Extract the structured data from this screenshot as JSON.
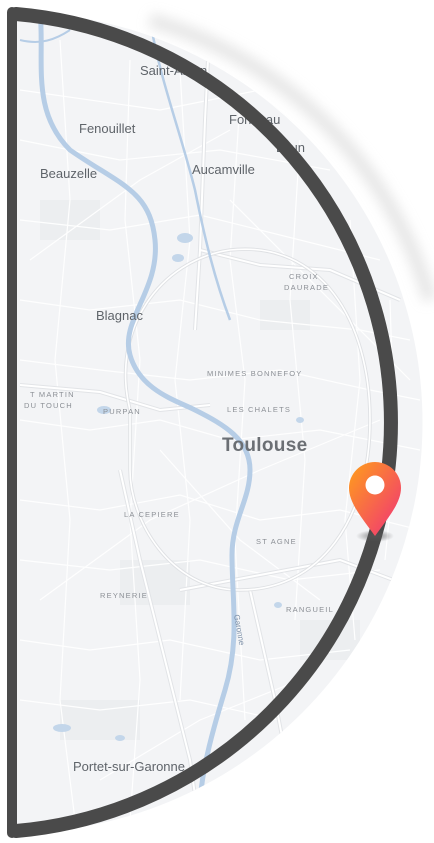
{
  "map": {
    "city_labels": {
      "saint_alban": "Saint-Alban",
      "fonbeauzard": "Fonbeau",
      "fenouillet": "Fenouillet",
      "launaguet": "Laun",
      "beauzelle": "Beauzelle",
      "aucamville": "Aucamville",
      "blagnac": "Blagnac",
      "toulouse": "Toulouse",
      "portet": "Portet-sur-Garonne"
    },
    "district_labels": {
      "croix_daurade_1": "CROIX",
      "croix_daurade_2": "DAURADE",
      "minimes": "MINIMES BONNEFOY",
      "saint_martin_1": "T MARTIN",
      "saint_martin_2": "DU TOUCH",
      "purpan": "PURPAN",
      "chalets": "LES CHALETS",
      "cepiere": "LA CEPIERE",
      "saint_agne": "ST AGNE",
      "reynerie": "REYNERIE",
      "rangueil": "RANGUEIL"
    },
    "river_label": "Garonne",
    "marker": {
      "gradient_start": "#ff9f1a",
      "gradient_end": "#f0307a"
    },
    "frame_color": "#4a4a4a",
    "water_color": "#b6cde6",
    "land_color": "#f3f4f6"
  }
}
